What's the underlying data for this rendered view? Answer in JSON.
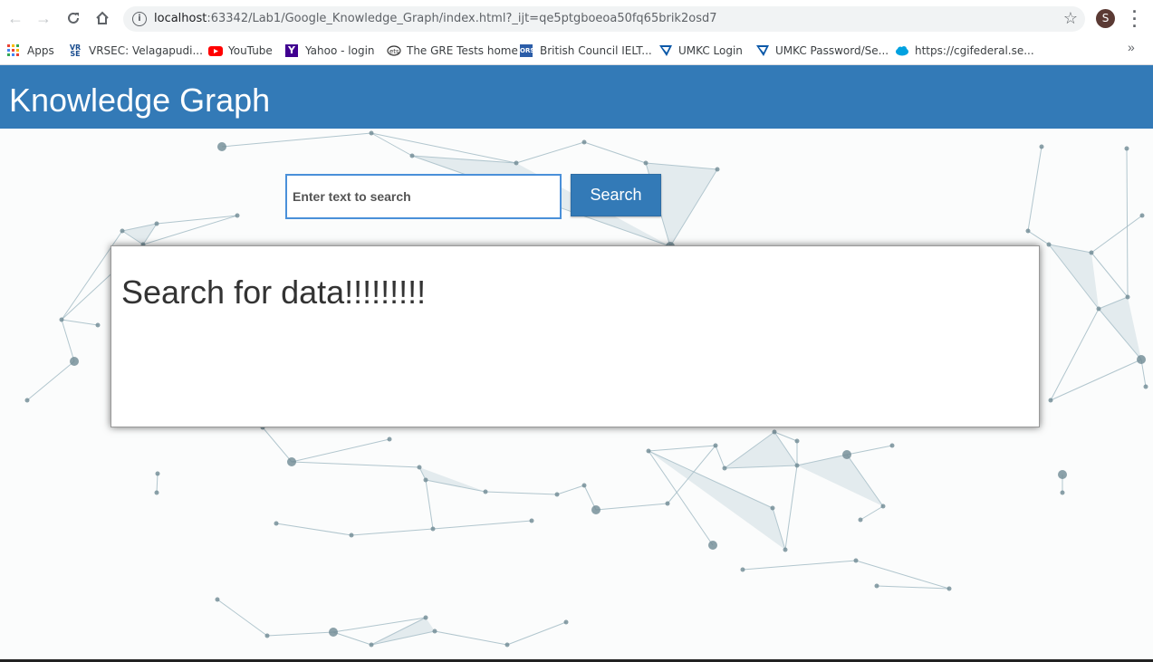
{
  "browser": {
    "url_host": "localhost",
    "url_rest": ":63342/Lab1/Google_Knowledge_Graph/index.html?_ijt=qe5ptgboeoa50fq65brik2osd7",
    "profile_initial": "S",
    "bookmarks": [
      {
        "label": "Apps",
        "icon": "apps-grid-icon"
      },
      {
        "label": "VRSEC: Velagapudi...",
        "icon": "vrsec-icon"
      },
      {
        "label": "YouTube",
        "icon": "youtube-icon"
      },
      {
        "label": "Yahoo - login",
        "icon": "yahoo-icon"
      },
      {
        "label": "The GRE Tests home",
        "icon": "ets-icon"
      },
      {
        "label": "British Council IELT...",
        "icon": "ielts-icon"
      },
      {
        "label": "UMKC Login",
        "icon": "umkc-icon"
      },
      {
        "label": "UMKC Password/Se...",
        "icon": "umkc-icon"
      },
      {
        "label": "https://cgifederal.se...",
        "icon": "cloud-icon"
      }
    ]
  },
  "header": {
    "title": "Knowledge Graph"
  },
  "search": {
    "placeholder": "Enter text to search",
    "button_label": "Search"
  },
  "result": {
    "text": "Search for data!!!!!!!!!"
  },
  "colors": {
    "header": "#337ab7",
    "button": "#337ab7",
    "input_border": "#4a90d9"
  }
}
